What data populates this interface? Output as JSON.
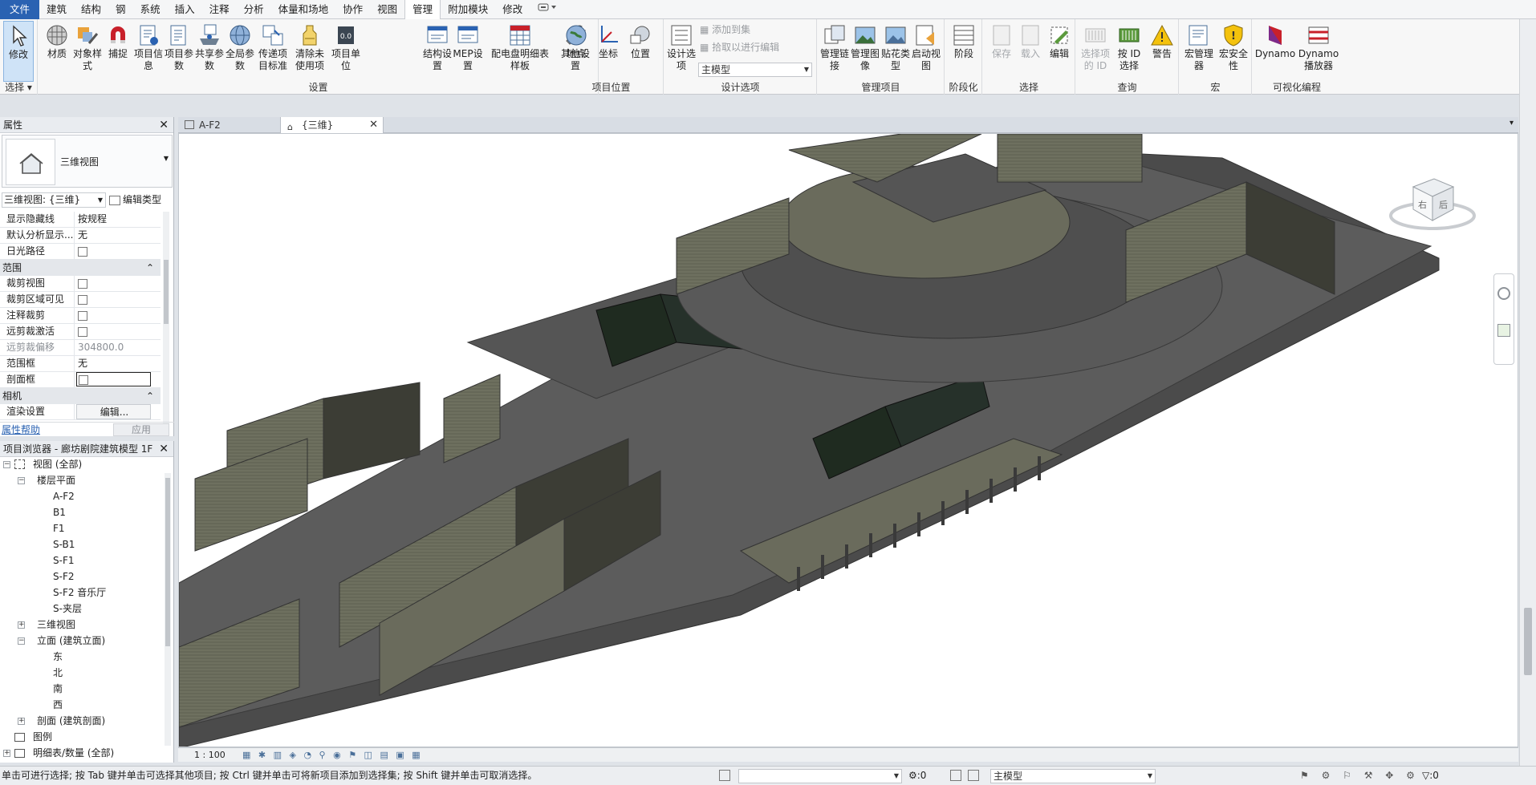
{
  "menu": {
    "tabs": [
      "文件",
      "建筑",
      "结构",
      "钢",
      "系统",
      "插入",
      "注释",
      "分析",
      "体量和场地",
      "协作",
      "视图",
      "管理",
      "附加模块",
      "修改"
    ],
    "active": "管理"
  },
  "ribbon": {
    "select_label": "修改",
    "select_group": "选择",
    "settings_group": "设置",
    "settings_buttons": [
      "材质",
      "对象样式",
      "捕捉",
      "项目信息",
      "项目参数",
      "共享参数",
      "全局参数",
      "传递项目标准",
      "清除未使用项",
      "项目单位",
      "结构设置",
      "MEP设置",
      "配电盘明细表样板",
      "其他设置"
    ],
    "location_group": "项目位置",
    "location_buttons": [
      "地点",
      "坐标",
      "位置"
    ],
    "design_group": "设计选项",
    "design_button": "设计选项",
    "design_add": "添加到集",
    "design_pick": "拾取以进行编辑",
    "design_select": "主模型",
    "manage_project_group": "管理项目",
    "manage_project_buttons": [
      "管理链接",
      "管理图像",
      "贴花类型",
      "启动视图"
    ],
    "phasing_group": "阶段化",
    "phasing_button": "阶段",
    "selection_group": "选择",
    "selection_buttons": [
      "保存",
      "载入",
      "编辑"
    ],
    "inquiry_group": "查询",
    "inquiry_buttons": [
      "选择项的 ID",
      "按 ID 选择",
      "警告"
    ],
    "macros_group": "宏",
    "macros_buttons": [
      "宏管理器",
      "宏安全性"
    ],
    "dynamo_group": "可视化编程",
    "dynamo_buttons": [
      "Dynamo",
      "Dynamo 播放器"
    ]
  },
  "view_tabs": [
    {
      "label": "A-F2"
    },
    {
      "label": "{三维}"
    }
  ],
  "properties": {
    "title": "属性",
    "type_name": "三维视图",
    "view_selector": "三维视图: {三维}",
    "edit_type": "编辑类型",
    "rows_top": [
      {
        "k": "显示隐藏线",
        "v": "按规程"
      },
      {
        "k": "默认分析显示...",
        "v": "无"
      },
      {
        "k": "日光路径",
        "v": ""
      }
    ],
    "section_extents": "范围",
    "rows_extents": [
      {
        "k": "裁剪视图",
        "v": ""
      },
      {
        "k": "裁剪区域可见",
        "v": ""
      },
      {
        "k": "注释裁剪",
        "v": ""
      },
      {
        "k": "远剪裁激活",
        "v": ""
      },
      {
        "k": "远剪裁偏移",
        "v": "304800.0"
      },
      {
        "k": "范围框",
        "v": "无"
      },
      {
        "k": "剖面框",
        "v": ""
      }
    ],
    "section_camera": "相机",
    "render_label": "渲染设置",
    "render_btn": "编辑...",
    "help_link": "属性帮助",
    "apply": "应用"
  },
  "browser": {
    "title": "项目浏览器 - 廊坊剧院建筑模型 1F",
    "views_all": "视图 (全部)",
    "floor_plans": "楼层平面",
    "floors": [
      "A-F2",
      "B1",
      "F1",
      "S-B1",
      "S-F1",
      "S-F2",
      "S-F2 音乐厅",
      "S-夹层"
    ],
    "threed": "三维视图",
    "elevations": "立面 (建筑立面)",
    "elev_items": [
      "东",
      "北",
      "南",
      "西"
    ],
    "sections": "剖面 (建筑剖面)",
    "legends": "图例",
    "schedules": "明细表/数量 (全部)"
  },
  "viewcube": {
    "left": "右",
    "right": "后"
  },
  "viewbar": {
    "scale": "1 : 100"
  },
  "status": {
    "message": "单击可进行选择; 按 Tab 键并单击可选择其他项目; 按 Ctrl 键并单击可将新项目添加到选择集; 按 Shift 键并单击可取消选择。",
    "worksets_count": ":0",
    "model": "主模型",
    "filter_count": ":0"
  }
}
